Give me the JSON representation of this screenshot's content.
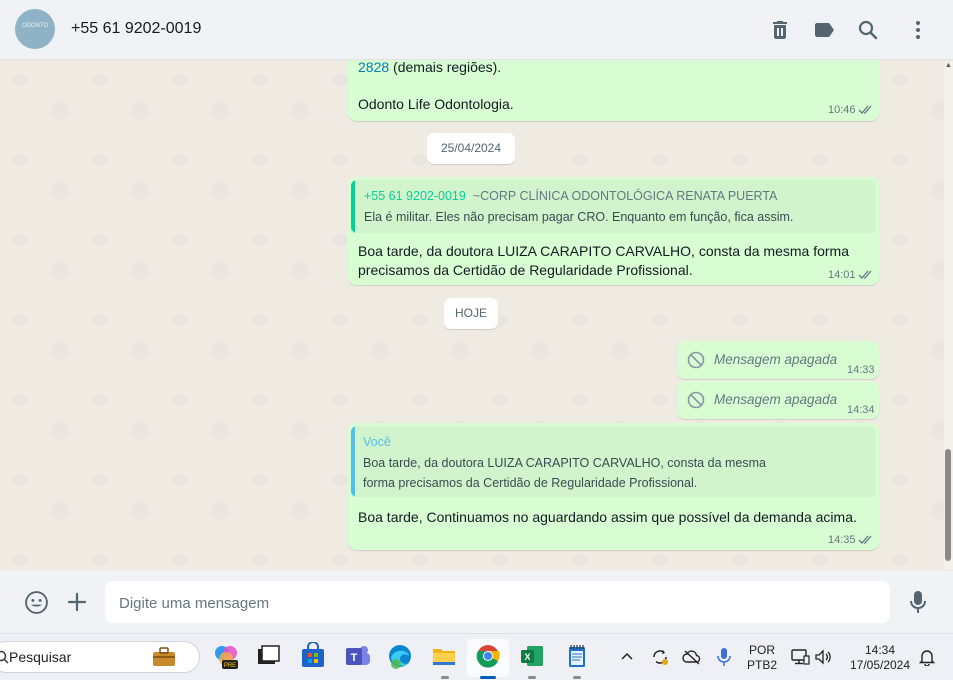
{
  "header": {
    "avatar_text": "ODONTO",
    "contact_name": "+55 61 9202-0019",
    "icons": [
      "trash-icon",
      "label-icon",
      "search-icon",
      "more-vertical-icon"
    ]
  },
  "messages": {
    "m1": {
      "line1_link": "2828",
      "line1_rest": " (demais regiões).",
      "line2": "Odonto Life Odontologia.",
      "time": "10:46"
    },
    "date1": "25/04/2024",
    "m2": {
      "quote_author": "+55 61 9202-0019",
      "quote_author_name": "~CORP CLÍNICA ODONTOLÓGICA RENATA PUERTA",
      "quote_text": "Ela é  militar. Eles não precisam pagar CRO. Enquanto em função, fica assim.",
      "line1": "Boa tarde, da doutora LUIZA CARAPITO CARVALHO, consta da mesma forma",
      "line2": "precisamos da Certidão de Regularidade Profissional.",
      "time": "14:01"
    },
    "date2": "HOJE",
    "m3": {
      "text": "Mensagem apagada",
      "time": "14:33"
    },
    "m4": {
      "text": "Mensagem apagada",
      "time": "14:34"
    },
    "m5": {
      "quote_author": "Você",
      "quote_line1": "Boa tarde, da doutora LUIZA CARAPITO CARVALHO, consta da mesma",
      "quote_line2": "forma precisamos da Certidão de Regularidade Profissional.",
      "text": "Boa tarde, Continuamos no aguardando assim que possível da demanda acima.",
      "time": "14:35"
    }
  },
  "composer": {
    "placeholder": "Digite uma mensagem"
  },
  "taskbar": {
    "search_label": "Pesquisar",
    "lang_line1": "POR",
    "lang_line2": "PTB2",
    "time": "14:34",
    "date": "17/05/2024"
  },
  "colors": {
    "outgoing_bubble": "#d9fdd3",
    "quote_bar_green": "#06cf9c",
    "quote_bar_blue": "#53bdeb",
    "link": "#027eb5",
    "read_ticks": "#667781"
  }
}
